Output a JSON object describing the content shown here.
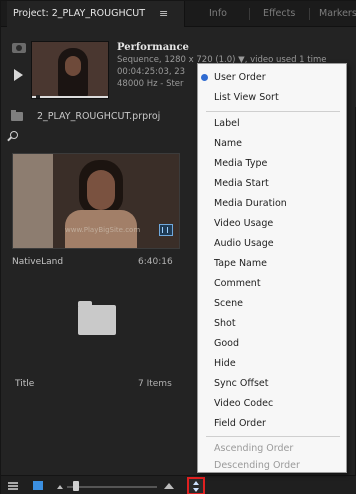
{
  "tabs": {
    "project": "Project: 2_PLAY_ROUGHCUT",
    "project_menu": "≡",
    "info": "Info",
    "effects": "Effects",
    "markers": "Markers"
  },
  "preview": {
    "title": "Performance",
    "line1": "Sequence, 1280 x 720 (1.0)  ▼, video used 1 time",
    "line2": "00:04:25:03, 23",
    "line3": "48000 Hz - Ster"
  },
  "project_file": "2_PLAY_ROUGHCUT.prproj",
  "items": {
    "video": {
      "name": "NativeLand",
      "duration": "6:40:16",
      "watermark": "www.PlayBigSite.com"
    },
    "bin": {
      "name": "Title",
      "count": "7 Items"
    }
  },
  "sort_menu": {
    "top": [
      "User Order",
      "List View Sort"
    ],
    "fields": [
      "Label",
      "Name",
      "Media Type",
      "Media Start",
      "Media Duration",
      "Video Usage",
      "Audio Usage",
      "Tape Name",
      "Comment",
      "Scene",
      "Shot",
      "Good",
      "Hide",
      "Sync Offset",
      "Video Codec",
      "Field Order"
    ],
    "order": [
      "Ascending Order",
      "Descending Order"
    ],
    "checked": "User Order"
  },
  "colors": {
    "accent": "#2f6bd1",
    "highlight_box": "#e02020",
    "icon_view_active": "#3b8fe0"
  }
}
